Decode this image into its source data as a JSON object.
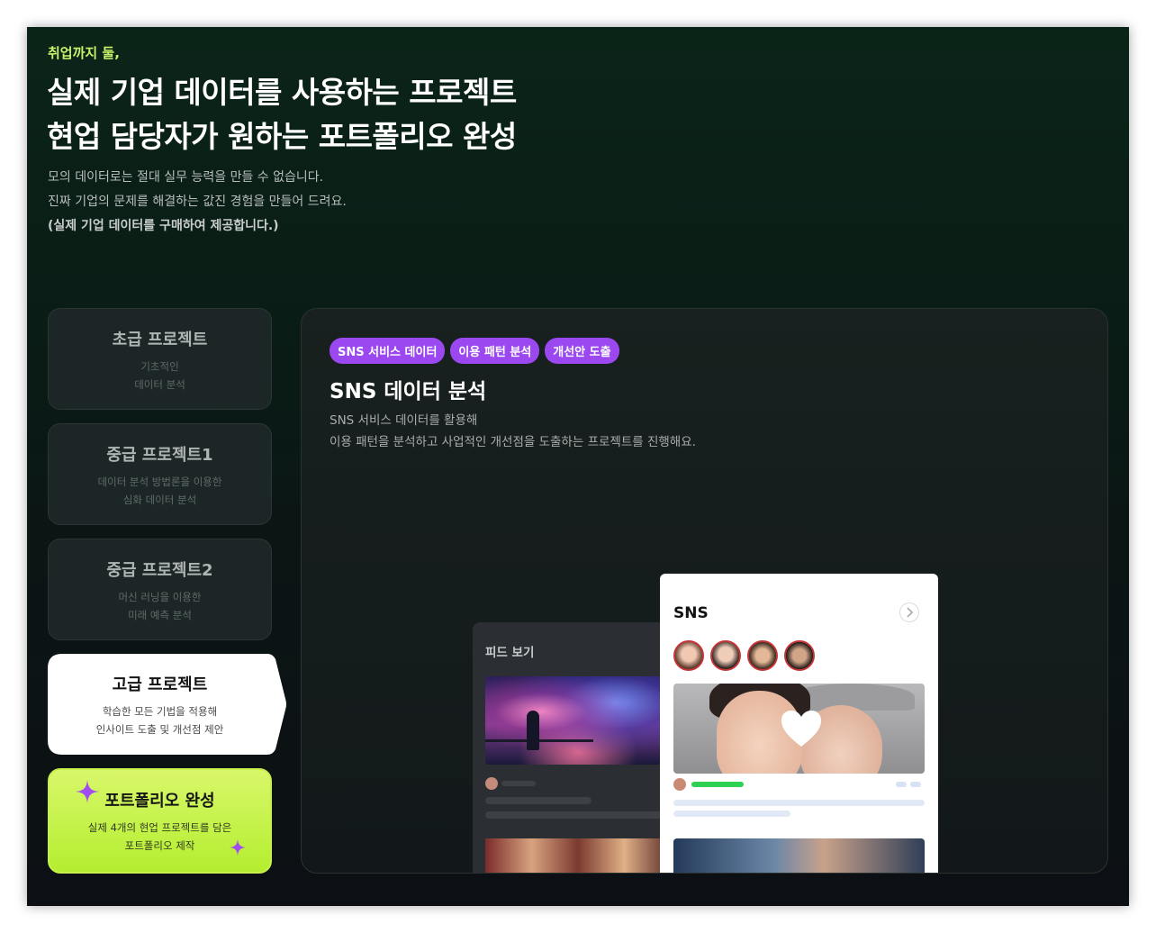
{
  "hero": {
    "eyebrow": "취업까지 둘,",
    "headline_line1": "실제 기업 데이터를 사용하는 프로젝트",
    "headline_line2": "현업 담당자가 원하는 포트폴리오 완성",
    "desc_line1": "모의 데이터로는 절대 실무 능력을 만들 수 없습니다.",
    "desc_line2": "진짜 기업의 문제를 해결하는 값진 경험을 만들어 드려요.",
    "desc_line3": "(실제 기업 데이터를 구매하여 제공합니다.)"
  },
  "steps": [
    {
      "title": "초급 프로젝트",
      "sub1": "기초적인",
      "sub2": "데이터 분석"
    },
    {
      "title": "중급 프로젝트1",
      "sub1": "데이터 분석 방법론을 이용한",
      "sub2": "심화 데이터 분석"
    },
    {
      "title": "중급 프로젝트2",
      "sub1": "머신 러닝을 이용한",
      "sub2": "미래 예측 분석"
    },
    {
      "title": "고급 프로젝트",
      "sub1": "학습한 모든 기법을 적용해",
      "sub2": "인사이트 도출 및 개선점 제안"
    },
    {
      "title": "포트폴리오 완성",
      "sub1": "실제 4개의 현업 프로젝트를 담은",
      "sub2": "포트폴리오 제작"
    }
  ],
  "panel": {
    "tags": [
      "SNS 서비스 데이터",
      "이용 패턴 분석",
      "개선안 도출"
    ],
    "title": "SNS 데이터 분석",
    "desc_line1": "SNS 서비스 데이터를 활용해",
    "desc_line2": "이용 패턴을 분석하고 사업적인 개선점을 도출하는 프로젝트를 진행해요."
  },
  "mock": {
    "feed_label": "피드 보기",
    "sns_title": "SNS"
  },
  "colors": {
    "accent_lime": "#c6f36b",
    "tag_purple": "#9b48f0",
    "progress_green": "#2fd155"
  }
}
